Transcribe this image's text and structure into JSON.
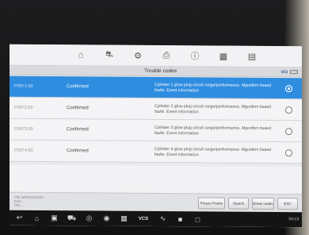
{
  "toolbar": {
    "icons": [
      "home-icon",
      "vehicle-switch-icon",
      "settings-icon",
      "print-icon",
      "help-icon",
      "save-icon",
      "data-icon"
    ]
  },
  "header": {
    "title": "Trouble codes",
    "vci_label": "VCI"
  },
  "codes": [
    {
      "code": "P0671:00",
      "status": "Confirmed",
      "description": "Cylinder 1 glow plug circuit range/performance. Algorithm based faults. Event information",
      "selected": true
    },
    {
      "code": "P0672:00",
      "status": "Confirmed",
      "description": "Cylinder 2 glow plug circuit range/performance. Algorithm based faults. Event information",
      "selected": false
    },
    {
      "code": "P0673:00",
      "status": "Confirmed",
      "description": "Cylinder 3 glow plug circuit range/performance. Algorithm based faults. Event information",
      "selected": false
    },
    {
      "code": "P0674:00",
      "status": "Confirmed",
      "description": "Cylinder 4 glow plug circuit range/performance. Algorithm based faults. Event information",
      "selected": false
    }
  ],
  "footer": {
    "vin_line1": "VIN: WF0XXXGCDX...",
    "vin_line2": "ECU: ...",
    "vin_line3": "CAL: ...",
    "freeze_frame": "Freeze Frame",
    "search": "Search",
    "erase_codes": "Erase codes",
    "esc": "ESC"
  },
  "navbar": {
    "vcs_label": "VCS",
    "time": "04:13"
  },
  "colors": {
    "selected_row": "#2f8de0",
    "accent": "#1a4f9c"
  }
}
